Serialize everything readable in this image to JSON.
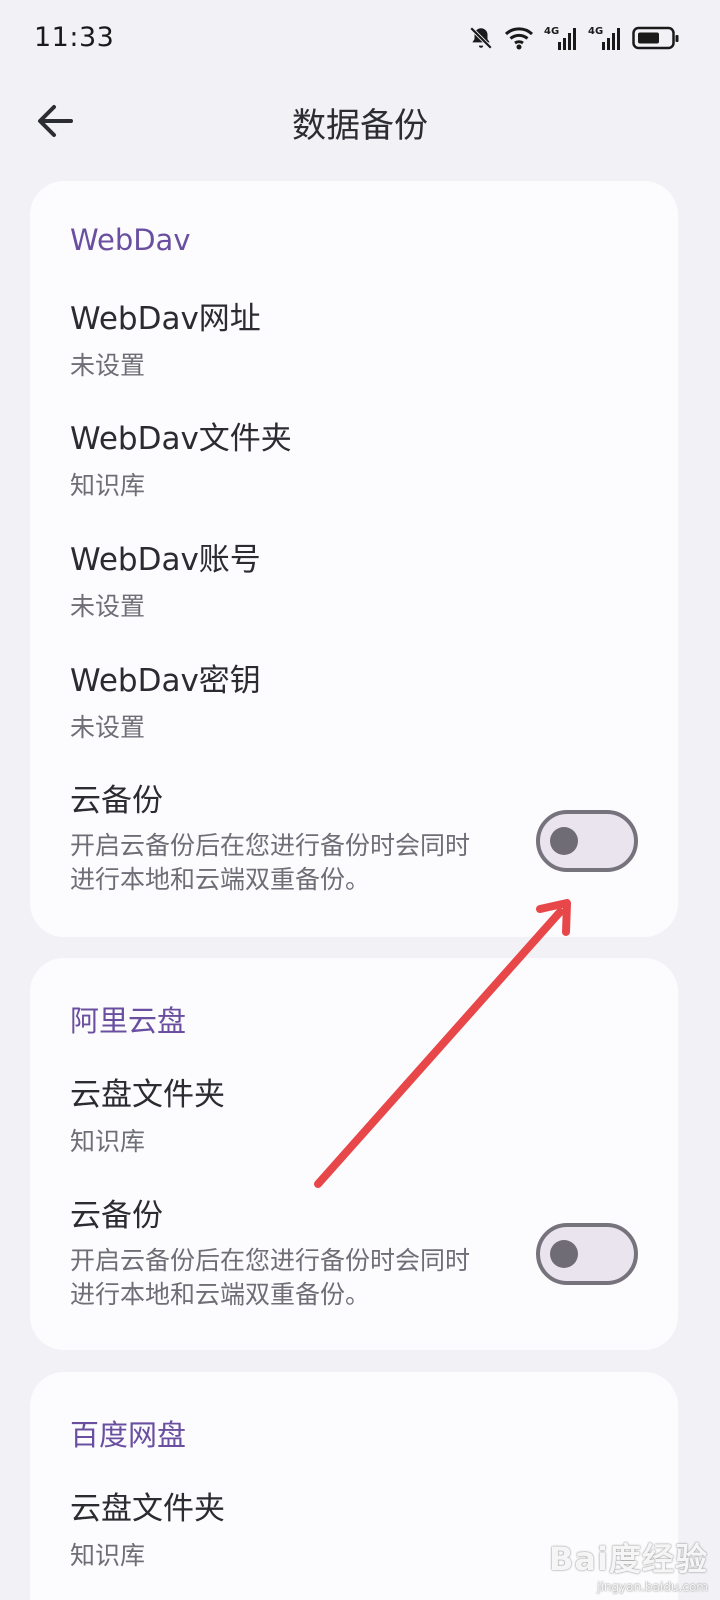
{
  "status": {
    "time": "11:33",
    "network_labels": [
      "4G",
      "4G"
    ]
  },
  "header": {
    "title": "数据备份"
  },
  "webdav": {
    "section_title": "WebDav",
    "items": [
      {
        "title": "WebDav网址",
        "value": "未设置"
      },
      {
        "title": "WebDav文件夹",
        "value": "知识库"
      },
      {
        "title": "WebDav账号",
        "value": "未设置"
      },
      {
        "title": "WebDav密钥",
        "value": "未设置"
      }
    ],
    "cloud_backup": {
      "title": "云备份",
      "description": "开启云备份后在您进行备份时会同时进行本地和云端双重备份。",
      "enabled": false
    }
  },
  "aliyun": {
    "section_title": "阿里云盘",
    "folder": {
      "title": "云盘文件夹",
      "value": "知识库"
    },
    "cloud_backup": {
      "title": "云备份",
      "description": "开启云备份后在您进行备份时会同时进行本地和云端双重备份。",
      "enabled": false
    }
  },
  "baidu": {
    "section_title": "百度网盘",
    "folder": {
      "title": "云盘文件夹",
      "value": "知识库"
    }
  },
  "watermark": {
    "brand": "Bai度经验",
    "url": "jingyan.baidu.com"
  },
  "colors": {
    "accent": "#6a4fa0",
    "annotation_arrow": "#e8474a",
    "background": "#f2f1f6",
    "card": "#fcfcfe"
  }
}
